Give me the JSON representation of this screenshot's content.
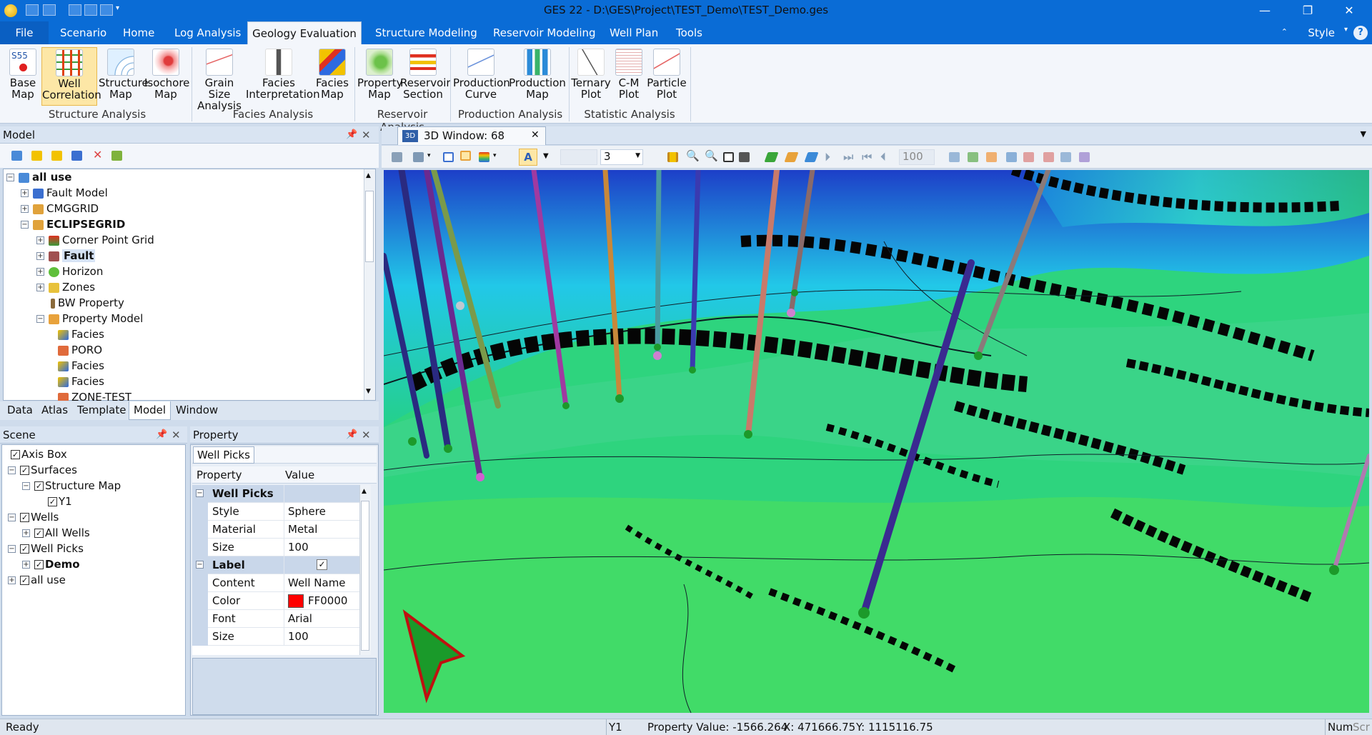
{
  "app": {
    "title": "GES 22 - D:\\GES\\Project\\TEST_Demo\\TEST_Demo.ges"
  },
  "menu": {
    "file": "File",
    "tabs": [
      "Scenario",
      "Home",
      "Log Analysis",
      "Geology Evaluation",
      "Structure Modeling",
      "Reservoir Modeling",
      "Well Plan",
      "Tools"
    ],
    "style": "Style",
    "help": "?"
  },
  "ribbon": {
    "buttons": [
      {
        "l1": "Base",
        "l2": "Map",
        "icon": "base-map-icon",
        "badge": "S55"
      },
      {
        "l1": "Well",
        "l2": "Correlation",
        "icon": "well-correlation-icon"
      },
      {
        "l1": "Structure",
        "l2": "Map",
        "icon": "structure-map-icon"
      },
      {
        "l1": "Isochore",
        "l2": "Map",
        "icon": "isochore-map-icon"
      },
      {
        "l1": "Grain Size",
        "l2": "Analysis",
        "icon": "grain-size-icon"
      },
      {
        "l1": "Facies",
        "l2": "Interpretation",
        "icon": "facies-interpretation-icon"
      },
      {
        "l1": "Facies",
        "l2": "Map",
        "icon": "facies-map-icon"
      },
      {
        "l1": "Property",
        "l2": "Map",
        "icon": "property-map-icon"
      },
      {
        "l1": "Reservoir",
        "l2": "Section",
        "icon": "reservoir-section-icon"
      },
      {
        "l1": "Production",
        "l2": "Curve",
        "icon": "production-curve-icon"
      },
      {
        "l1": "Production",
        "l2": "Map",
        "icon": "production-map-icon"
      },
      {
        "l1": "Ternary",
        "l2": "Plot",
        "icon": "ternary-plot-icon"
      },
      {
        "l1": "C-M",
        "l2": "Plot",
        "icon": "cm-plot-icon"
      },
      {
        "l1": "Particle",
        "l2": "Plot",
        "icon": "particle-plot-icon"
      }
    ],
    "groups": [
      "Structure Analysis",
      "Facies Analysis",
      "Reservoir Analysis",
      "Production Analysis",
      "Statistic Analysis"
    ]
  },
  "model": {
    "title": "Model",
    "tree": [
      "all use",
      "Fault Model",
      "CMGGRID",
      "ECLIPSEGRID",
      "Corner Point Grid",
      "Fault",
      "Horizon",
      "Zones",
      "BW Property",
      "Property Model",
      "Facies",
      "PORO",
      "Facies",
      "Facies",
      "ZONE-TEST"
    ]
  },
  "bottom_tabs": [
    "Data",
    "Atlas",
    "Template",
    "Model",
    "Window"
  ],
  "scene": {
    "title": "Scene",
    "tree": [
      "Axis Box",
      "Surfaces",
      "Structure Map",
      "Y1",
      "Wells",
      "All Wells",
      "Well Picks",
      "Demo",
      "all use"
    ]
  },
  "property": {
    "title": "Property",
    "tab": "Well Picks",
    "col_property": "Property",
    "col_value": "Value",
    "rows": [
      {
        "k": "Well Picks",
        "v": "",
        "cat": true
      },
      {
        "k": "Style",
        "v": "Sphere"
      },
      {
        "k": "Material",
        "v": "Metal"
      },
      {
        "k": "Size",
        "v": "100"
      },
      {
        "k": "Label",
        "v": "✓",
        "cat": true
      },
      {
        "k": "Content",
        "v": "Well Name"
      },
      {
        "k": "Color",
        "v": "FF0000"
      },
      {
        "k": "Font",
        "v": "Arial"
      },
      {
        "k": "Size",
        "v": "100"
      }
    ],
    "color_swatch": "#ff0000"
  },
  "viewer": {
    "tab": "3D Window: 68",
    "tab_icon": "3D",
    "combo_value": "3",
    "spin_value": "100"
  },
  "status": {
    "ready": "Ready",
    "surface": "Y1",
    "property_value": "Property Value: -1566.264",
    "x": "X: 471666.75",
    "y": "Y: 1115116.75",
    "num": "Num",
    "scroll": "Scr"
  }
}
